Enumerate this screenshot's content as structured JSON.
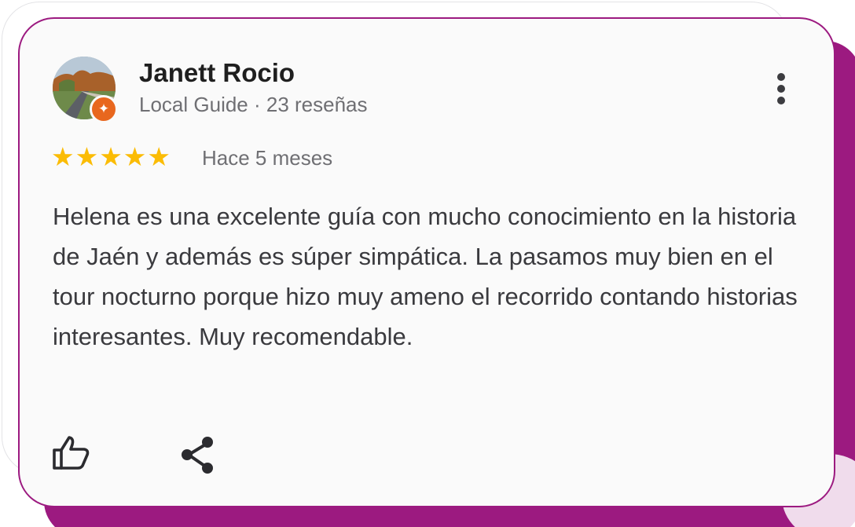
{
  "review": {
    "author_name": "Janett Rocio",
    "author_meta": "Local Guide · 23 reseñas",
    "rating": 5,
    "rating_max": 5,
    "stars": [
      "★",
      "★",
      "★",
      "★",
      "★"
    ],
    "date": "Hace 5 meses",
    "text": "Helena es una excelente guía con mucho conocimiento en la historia de Jaén y además es súper simpática. La pasamos muy bien en el tour nocturno porque hizo muy ameno el recorrido contando historias interesantes. Muy recomendable."
  },
  "icons": {
    "avatar": "profile-photo",
    "badge": "local-guide-badge-icon",
    "more": "more-vert-icon",
    "like": "thumb-up-icon",
    "share": "share-icon"
  },
  "colors": {
    "accent_purple": "#9c1a80",
    "star_yellow": "#fbbc05",
    "badge_orange": "#e8671e",
    "name_text": "#1f1f1f",
    "meta_text": "#6f6f73",
    "body_text": "#3a3a3e",
    "card_background": "#fafafa"
  }
}
